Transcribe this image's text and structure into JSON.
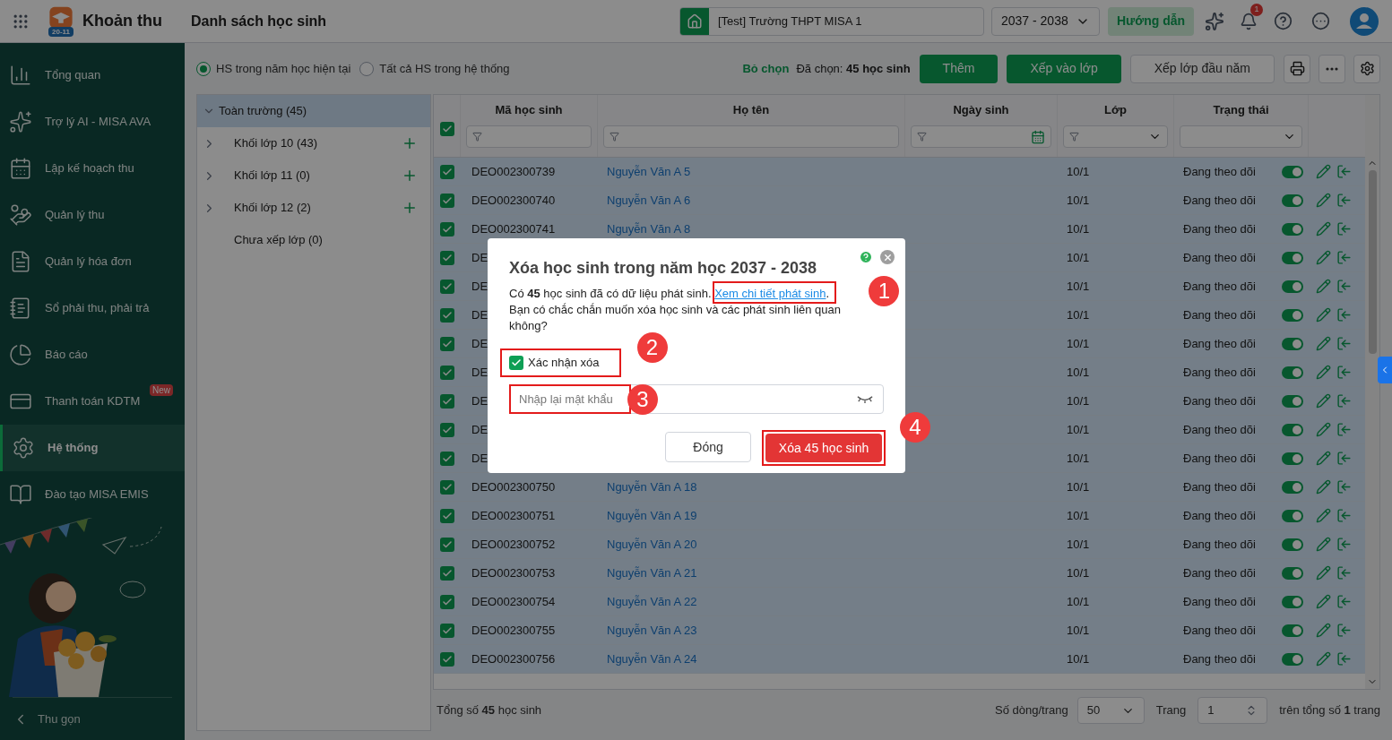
{
  "app": {
    "title": "Khoản thu",
    "logo_badge": "20-11"
  },
  "header": {
    "title": "Danh sách học sinh",
    "school": "[Test] Trường THPT MISA 1",
    "year": "2037 - 2038",
    "guide_button": "Hướng dẫn",
    "notification_count": "1"
  },
  "sidebar": {
    "items": [
      {
        "label": "Tổng quan",
        "kind": "overview",
        "selected": false
      },
      {
        "label": "Trợ lý AI - MISA AVA",
        "kind": "ai",
        "selected": false
      },
      {
        "label": "Lập kế hoạch thu",
        "kind": "plan",
        "selected": false
      },
      {
        "label": "Quản lý thu",
        "kind": "collect",
        "selected": false
      },
      {
        "label": "Quản lý hóa đơn",
        "kind": "invoice",
        "selected": false
      },
      {
        "label": "Sổ phải thu, phải trả",
        "kind": "ledger",
        "selected": false
      },
      {
        "label": "Báo cáo",
        "kind": "report",
        "selected": false
      },
      {
        "label": "Thanh toán KDTM",
        "kind": "payment",
        "selected": false,
        "badge": "New"
      },
      {
        "label": "Hệ thống",
        "kind": "system",
        "selected": true
      },
      {
        "label": "Đào tạo MISA EMIS",
        "kind": "training",
        "selected": false
      }
    ],
    "collapse": "Thu gọn"
  },
  "scope": [
    {
      "label": "HS trong năm học hiện tại",
      "selected": true
    },
    {
      "label": "Tất cả HS trong hệ thống",
      "selected": false
    }
  ],
  "toolbar": {
    "deselect": "Bỏ chọn",
    "selected_text": "Đã chọn: **45 học sinh**",
    "buttons": [
      {
        "label": "Thêm",
        "kind": "primary"
      },
      {
        "label": "Xếp vào lớp",
        "kind": "primary"
      },
      {
        "label": "Xếp lớp đầu năm",
        "kind": "secondary"
      }
    ]
  },
  "tree": {
    "label": "Toàn trường (45)",
    "expanded": true,
    "selected": true,
    "children": [
      {
        "label": "Khối lớp 10 (43)",
        "kind": "grade"
      },
      {
        "label": "Khối lớp 11 (0)",
        "kind": "grade"
      },
      {
        "label": "Khối lớp 12 (2)",
        "kind": "grade"
      },
      {
        "label": "Chưa xếp lớp (0)",
        "kind": "unassigned"
      }
    ]
  },
  "table": {
    "all_checked": true,
    "columns": [
      {
        "label": "Mã học sinh",
        "kind": "text"
      },
      {
        "label": "Họ tên",
        "kind": "text"
      },
      {
        "label": "Ngày sinh",
        "kind": "date"
      },
      {
        "label": "Lớp",
        "kind": "select"
      },
      {
        "label": "Trạng thái",
        "kind": "dropdown"
      }
    ],
    "rows": [
      {
        "checked": true,
        "id": "DEO002300739",
        "name": "Nguyễn Văn A 5",
        "class": "10/1",
        "status": "Đang theo dõi",
        "active": true
      },
      {
        "checked": true,
        "id": "DEO002300740",
        "name": "Nguyễn Văn A 6",
        "class": "10/1",
        "status": "Đang theo dõi",
        "active": true
      },
      {
        "checked": true,
        "id": "DEO002300741",
        "name": "Nguyễn Văn A 8",
        "class": "10/1",
        "status": "Đang theo dõi",
        "active": true
      },
      {
        "checked": true,
        "id": "DE",
        "class": "10/1",
        "status": "Đang theo dõi",
        "active": true
      },
      {
        "checked": true,
        "id": "DE",
        "class": "10/1",
        "status": "Đang theo dõi",
        "active": true
      },
      {
        "checked": true,
        "id": "DE",
        "class": "10/1",
        "status": "Đang theo dõi",
        "active": true
      },
      {
        "checked": true,
        "id": "DE",
        "class": "10/1",
        "status": "Đang theo dõi",
        "active": true
      },
      {
        "checked": true,
        "id": "DE",
        "class": "10/1",
        "status": "Đang theo dõi",
        "active": true
      },
      {
        "checked": true,
        "id": "DE",
        "class": "10/1",
        "status": "Đang theo dõi",
        "active": true
      },
      {
        "checked": true,
        "id": "DE",
        "class": "10/1",
        "status": "Đang theo dõi",
        "active": true
      },
      {
        "checked": true,
        "id": "DE",
        "class": "10/1",
        "status": "Đang theo dõi",
        "active": true
      },
      {
        "checked": true,
        "id": "DEO002300750",
        "name": "Nguyễn Văn A 18",
        "class": "10/1",
        "status": "Đang theo dõi",
        "active": true
      },
      {
        "checked": true,
        "id": "DEO002300751",
        "name": "Nguyễn Văn A 19",
        "class": "10/1",
        "status": "Đang theo dõi",
        "active": true
      },
      {
        "checked": true,
        "id": "DEO002300752",
        "name": "Nguyễn Văn A 20",
        "class": "10/1",
        "status": "Đang theo dõi",
        "active": true
      },
      {
        "checked": true,
        "id": "DEO002300753",
        "name": "Nguyễn Văn A 21",
        "class": "10/1",
        "status": "Đang theo dõi",
        "active": true
      },
      {
        "checked": true,
        "id": "DEO002300754",
        "name": "Nguyễn Văn A 22",
        "class": "10/1",
        "status": "Đang theo dõi",
        "active": true
      },
      {
        "checked": true,
        "id": "DEO002300755",
        "name": "Nguyễn Văn A 23",
        "class": "10/1",
        "status": "Đang theo dõi",
        "active": true
      },
      {
        "checked": true,
        "id": "DEO002300756",
        "name": "Nguyễn Văn A 24",
        "class": "10/1",
        "status": "Đang theo dõi",
        "active": true
      }
    ]
  },
  "footer": {
    "total": "Tổng số **45** học sinh",
    "page_size_label": "Số dòng/trang",
    "page_size": "50",
    "page_label": "Trang",
    "page": "1",
    "page_total": "trên tổng số **1** trang"
  },
  "dialog": {
    "title": "Xóa học sinh trong năm học 2037 - 2038",
    "message": "Có **45** học sinh đã có dữ liệu phát sinh.",
    "link": "Xem chi tiết phát sinh",
    "link_after": ".",
    "question": "Bạn có chắc chắn muốn xóa học sinh và các phát sinh liên quan không?",
    "confirm": {
      "label": "Xác nhận xóa",
      "checked": true
    },
    "password_placeholder": "Nhập lại mật khẩu",
    "cancel": "Đóng",
    "delete": "Xóa 45 học sinh"
  },
  "annotations": [
    "1",
    "2",
    "3",
    "4"
  ]
}
